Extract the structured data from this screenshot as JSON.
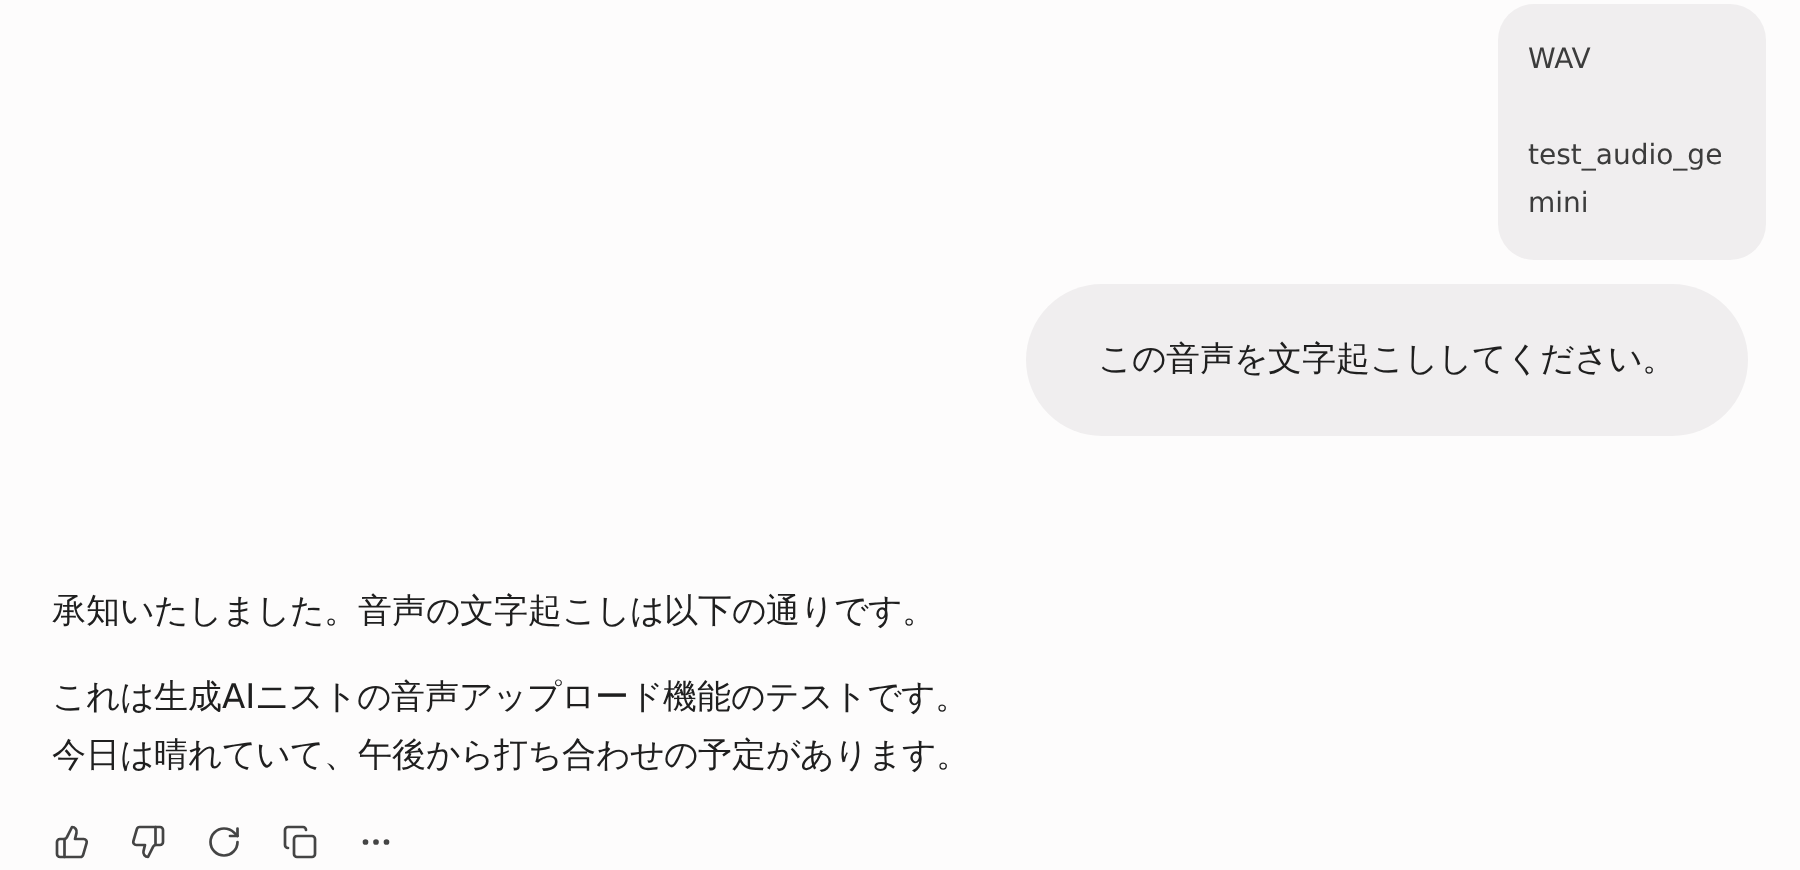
{
  "user_message": {
    "attachment": {
      "type": "WAV",
      "name": "test_audio_gemini"
    },
    "text": "この音声を文字起こししてください。"
  },
  "response": {
    "paragraphs": [
      [
        "承知いたしました。音声の文字起こしは以下の通りです。"
      ],
      [
        "これは生成AIニストの音声アップロード機能のテストです。",
        "今日は晴れていて、午後から打ち合わせの予定があります。"
      ]
    ]
  },
  "actions": [
    {
      "kind": "thumbs-up"
    },
    {
      "kind": "thumbs-down"
    },
    {
      "kind": "regenerate"
    },
    {
      "kind": "copy"
    },
    {
      "kind": "more"
    }
  ]
}
